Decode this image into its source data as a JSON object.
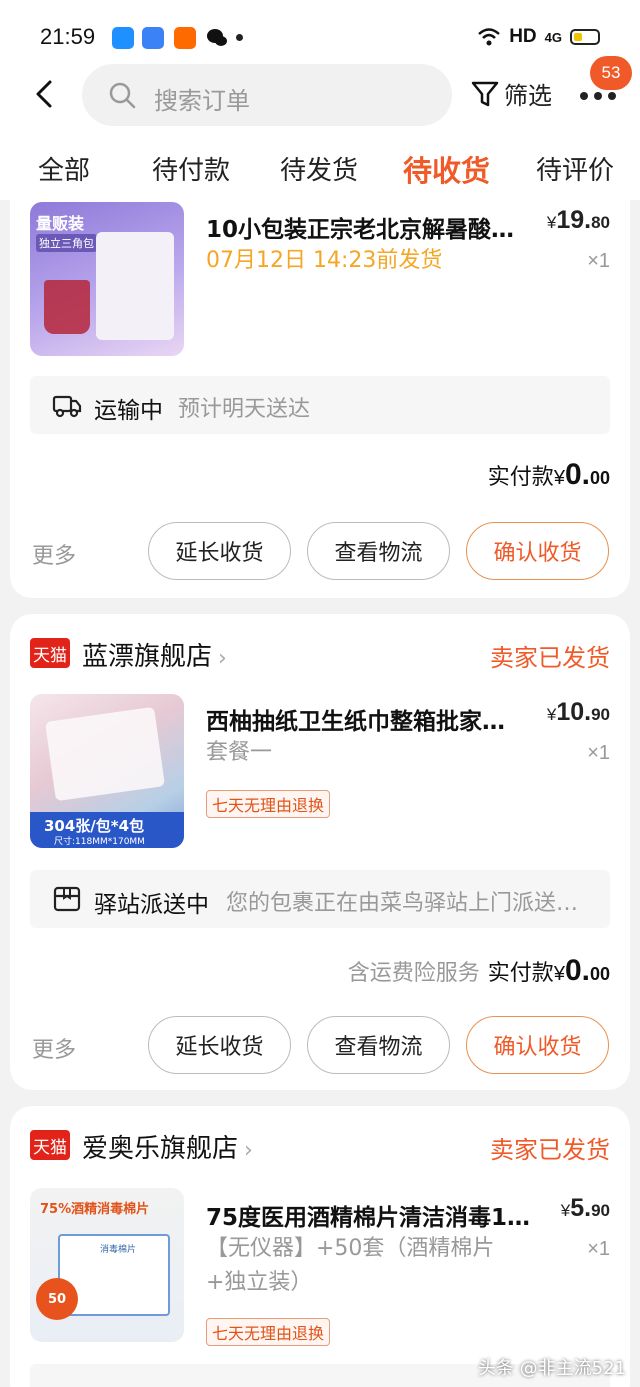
{
  "status_bar": {
    "time": "21:59",
    "network": "HD",
    "signal": "4G"
  },
  "header": {
    "search_placeholder": "搜索订单",
    "filter_label": "筛选",
    "notification_count": "53"
  },
  "tabs": [
    {
      "label": "全部",
      "active": false
    },
    {
      "label": "待付款",
      "active": false
    },
    {
      "label": "待发货",
      "active": false
    },
    {
      "label": "待收货",
      "active": true
    },
    {
      "label": "待评价",
      "active": false
    }
  ],
  "orders": [
    {
      "shop_badge": "",
      "shop_name": "",
      "shop_status": "",
      "product": {
        "thumb_text_1": "量贩装",
        "thumb_text_2": "独立三角包",
        "title": "10小包装正宗老北京解暑酸…",
        "price_yen": "¥",
        "price_int": "19.",
        "price_dec": "80",
        "spec": "07月12日 14:23前发货",
        "qty": "×1"
      },
      "logistics": {
        "status": "运输中",
        "desc": "预计明天送达"
      },
      "paid": {
        "extra": "",
        "label": "实付款",
        "yen": "¥",
        "int": "0.",
        "dec": "00"
      },
      "actions": {
        "more": "更多",
        "extend": "延长收货",
        "track": "查看物流",
        "confirm": "确认收货"
      }
    },
    {
      "shop_badge": "天猫",
      "shop_name": "蓝漂旗舰店",
      "shop_status": "卖家已发货",
      "product": {
        "thumb_text_1": "304张/包*4包",
        "thumb_text_2": "尺寸:118MM*170MM",
        "title": "西柚抽纸卫生纸巾整箱批家…",
        "price_yen": "¥",
        "price_int": "10.",
        "price_dec": "90",
        "spec": "套餐一",
        "qty": "×1",
        "tag": "七天无理由退换"
      },
      "logistics": {
        "status": "驿站派送中",
        "desc": "您的包裹正在由菜鸟驿站上门派送…"
      },
      "paid": {
        "extra": "含运费险服务",
        "label": "实付款",
        "yen": "¥",
        "int": "0.",
        "dec": "00"
      },
      "actions": {
        "more": "更多",
        "extend": "延长收货",
        "track": "查看物流",
        "confirm": "确认收货"
      }
    },
    {
      "shop_badge": "天猫",
      "shop_name": "爱奥乐旗舰店",
      "shop_status": "卖家已发货",
      "product": {
        "thumb_text_1": "75%酒精消毒棉片",
        "thumb_text_2": "消毒棉片",
        "thumb_text_3": "50",
        "title": "75度医用酒精棉片清洁消毒10…",
        "price_yen": "¥",
        "price_int": "5.",
        "price_dec": "90",
        "spec": "【无仪器】+50套（酒精棉片+独立装）",
        "qty": "×1",
        "tag": "七天无理由退换"
      }
    }
  ],
  "watermark": "头条 @非主流521",
  "colors": {
    "accent": "#f05a28",
    "tmall": "#e2231a",
    "ship_date": "#f5a623"
  }
}
